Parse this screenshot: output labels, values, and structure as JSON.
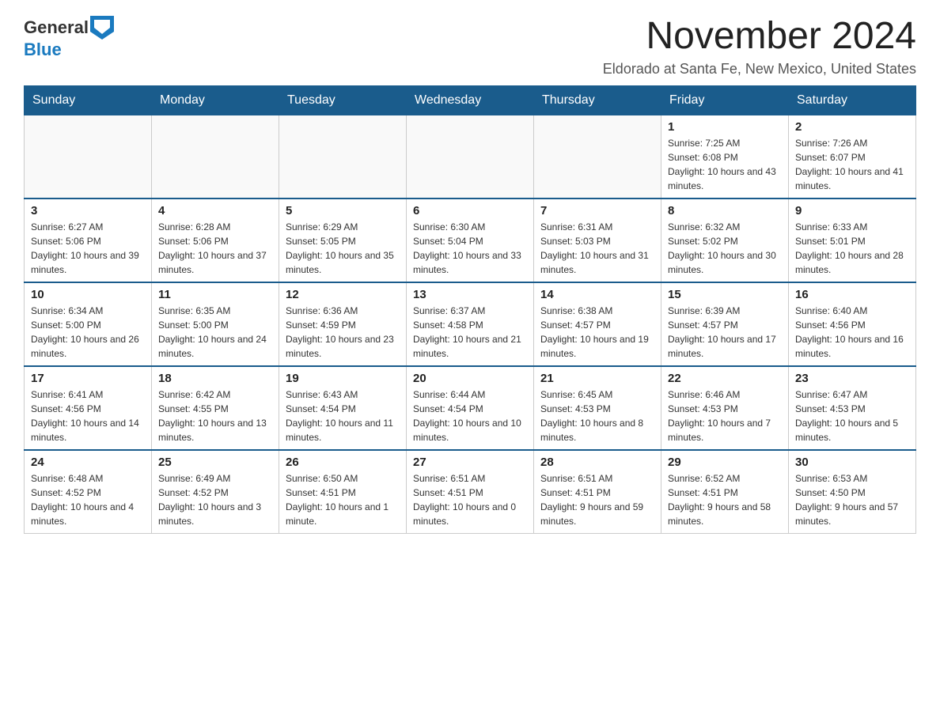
{
  "header": {
    "logo_general": "General",
    "logo_blue": "Blue",
    "month_title": "November 2024",
    "location": "Eldorado at Santa Fe, New Mexico, United States"
  },
  "days_of_week": [
    "Sunday",
    "Monday",
    "Tuesday",
    "Wednesday",
    "Thursday",
    "Friday",
    "Saturday"
  ],
  "weeks": [
    [
      {
        "day": "",
        "info": ""
      },
      {
        "day": "",
        "info": ""
      },
      {
        "day": "",
        "info": ""
      },
      {
        "day": "",
        "info": ""
      },
      {
        "day": "",
        "info": ""
      },
      {
        "day": "1",
        "info": "Sunrise: 7:25 AM\nSunset: 6:08 PM\nDaylight: 10 hours and 43 minutes."
      },
      {
        "day": "2",
        "info": "Sunrise: 7:26 AM\nSunset: 6:07 PM\nDaylight: 10 hours and 41 minutes."
      }
    ],
    [
      {
        "day": "3",
        "info": "Sunrise: 6:27 AM\nSunset: 5:06 PM\nDaylight: 10 hours and 39 minutes."
      },
      {
        "day": "4",
        "info": "Sunrise: 6:28 AM\nSunset: 5:06 PM\nDaylight: 10 hours and 37 minutes."
      },
      {
        "day": "5",
        "info": "Sunrise: 6:29 AM\nSunset: 5:05 PM\nDaylight: 10 hours and 35 minutes."
      },
      {
        "day": "6",
        "info": "Sunrise: 6:30 AM\nSunset: 5:04 PM\nDaylight: 10 hours and 33 minutes."
      },
      {
        "day": "7",
        "info": "Sunrise: 6:31 AM\nSunset: 5:03 PM\nDaylight: 10 hours and 31 minutes."
      },
      {
        "day": "8",
        "info": "Sunrise: 6:32 AM\nSunset: 5:02 PM\nDaylight: 10 hours and 30 minutes."
      },
      {
        "day": "9",
        "info": "Sunrise: 6:33 AM\nSunset: 5:01 PM\nDaylight: 10 hours and 28 minutes."
      }
    ],
    [
      {
        "day": "10",
        "info": "Sunrise: 6:34 AM\nSunset: 5:00 PM\nDaylight: 10 hours and 26 minutes."
      },
      {
        "day": "11",
        "info": "Sunrise: 6:35 AM\nSunset: 5:00 PM\nDaylight: 10 hours and 24 minutes."
      },
      {
        "day": "12",
        "info": "Sunrise: 6:36 AM\nSunset: 4:59 PM\nDaylight: 10 hours and 23 minutes."
      },
      {
        "day": "13",
        "info": "Sunrise: 6:37 AM\nSunset: 4:58 PM\nDaylight: 10 hours and 21 minutes."
      },
      {
        "day": "14",
        "info": "Sunrise: 6:38 AM\nSunset: 4:57 PM\nDaylight: 10 hours and 19 minutes."
      },
      {
        "day": "15",
        "info": "Sunrise: 6:39 AM\nSunset: 4:57 PM\nDaylight: 10 hours and 17 minutes."
      },
      {
        "day": "16",
        "info": "Sunrise: 6:40 AM\nSunset: 4:56 PM\nDaylight: 10 hours and 16 minutes."
      }
    ],
    [
      {
        "day": "17",
        "info": "Sunrise: 6:41 AM\nSunset: 4:56 PM\nDaylight: 10 hours and 14 minutes."
      },
      {
        "day": "18",
        "info": "Sunrise: 6:42 AM\nSunset: 4:55 PM\nDaylight: 10 hours and 13 minutes."
      },
      {
        "day": "19",
        "info": "Sunrise: 6:43 AM\nSunset: 4:54 PM\nDaylight: 10 hours and 11 minutes."
      },
      {
        "day": "20",
        "info": "Sunrise: 6:44 AM\nSunset: 4:54 PM\nDaylight: 10 hours and 10 minutes."
      },
      {
        "day": "21",
        "info": "Sunrise: 6:45 AM\nSunset: 4:53 PM\nDaylight: 10 hours and 8 minutes."
      },
      {
        "day": "22",
        "info": "Sunrise: 6:46 AM\nSunset: 4:53 PM\nDaylight: 10 hours and 7 minutes."
      },
      {
        "day": "23",
        "info": "Sunrise: 6:47 AM\nSunset: 4:53 PM\nDaylight: 10 hours and 5 minutes."
      }
    ],
    [
      {
        "day": "24",
        "info": "Sunrise: 6:48 AM\nSunset: 4:52 PM\nDaylight: 10 hours and 4 minutes."
      },
      {
        "day": "25",
        "info": "Sunrise: 6:49 AM\nSunset: 4:52 PM\nDaylight: 10 hours and 3 minutes."
      },
      {
        "day": "26",
        "info": "Sunrise: 6:50 AM\nSunset: 4:51 PM\nDaylight: 10 hours and 1 minute."
      },
      {
        "day": "27",
        "info": "Sunrise: 6:51 AM\nSunset: 4:51 PM\nDaylight: 10 hours and 0 minutes."
      },
      {
        "day": "28",
        "info": "Sunrise: 6:51 AM\nSunset: 4:51 PM\nDaylight: 9 hours and 59 minutes."
      },
      {
        "day": "29",
        "info": "Sunrise: 6:52 AM\nSunset: 4:51 PM\nDaylight: 9 hours and 58 minutes."
      },
      {
        "day": "30",
        "info": "Sunrise: 6:53 AM\nSunset: 4:50 PM\nDaylight: 9 hours and 57 minutes."
      }
    ]
  ]
}
